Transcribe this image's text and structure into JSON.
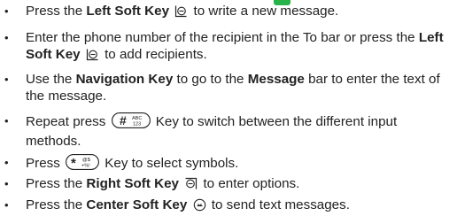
{
  "page": {
    "bullet": "•"
  },
  "steps": [
    {
      "a": "Press the ",
      "b1": "Left Soft Key",
      "c": " to write a new message.",
      "icon": "left-soft-key-icon"
    },
    {
      "a": "Enter the phone number of the recipient in the To bar or press the ",
      "b1": "Left Soft Key",
      "c": " to add recipients.",
      "icon": "left-soft-key-icon"
    },
    {
      "a": "Use the ",
      "b1": "Navigation Key",
      "m": " to go to the ",
      "b2": "Message",
      "c": " bar to enter the text of the message."
    },
    {
      "a": "Repeat press ",
      "c": " Key to switch between the different input methods.",
      "icon": "hash-key-icon",
      "key_sub": "ABC\n123"
    },
    {
      "a": "Press ",
      "c": " Key to select symbols.",
      "icon": "star-key-icon",
      "key_sub": "@$\n+%!"
    },
    {
      "a": "Press the ",
      "b1": "Right Soft Key",
      "c": " to enter options.",
      "icon": "right-soft-key-icon"
    },
    {
      "a": "Press the ",
      "b1": "Center Soft Key",
      "c": " to send text messages.",
      "icon": "center-soft-key-icon"
    }
  ]
}
